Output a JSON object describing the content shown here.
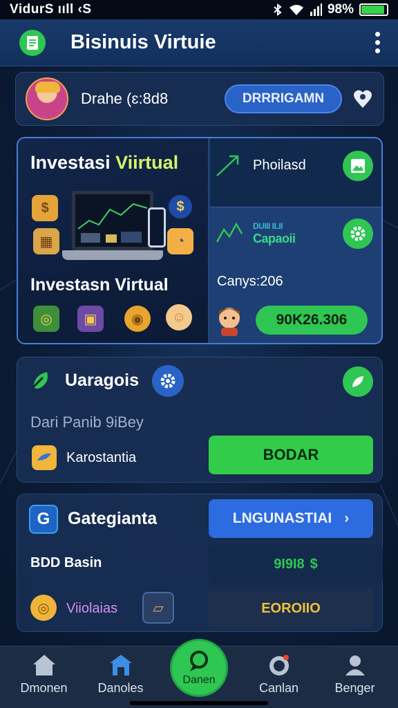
{
  "status_bar": {
    "left": "VidurS ııll  ‹S",
    "battery": "98%"
  },
  "app_bar": {
    "title": "Bisinuis Virtuie"
  },
  "profile": {
    "name": "Drahe (ɛ:8d8",
    "button": "DRRRIGAMN"
  },
  "invest_card": {
    "title_1_a": "Investasi ",
    "title_1_b": "Viirtual",
    "title_2": "Investasn Virtual",
    "portfolio_label": "Phoilasd",
    "data_label_1": "DUIII ILII",
    "data_label_2": "Capaoii",
    "change_label": "Canys:206",
    "balance_button": "90K26.306"
  },
  "section_2": {
    "title": "Uaragois",
    "subtitle": "Dari  Panib 9iBey",
    "row_label": "Karostantia",
    "button": "BODAR"
  },
  "section_3": {
    "title": "Gategianta",
    "button": "LNGUNASTIAI",
    "label_1": "BDD  Basin",
    "value_1": "9I9I8",
    "value_1_symbol": "$",
    "label_2": "Viiolaias",
    "value_2": "EOROIIO"
  },
  "bottom_nav": {
    "items": [
      {
        "label": "Dmonen",
        "icon": "home-icon"
      },
      {
        "label": "Danoles",
        "icon": "store-icon"
      },
      {
        "label": "Danen",
        "icon": "chat-icon"
      },
      {
        "label": "Canlan",
        "icon": "record-icon"
      },
      {
        "label": "Benger",
        "icon": "person-icon"
      }
    ]
  },
  "colors": {
    "accent_green": "#2fc653",
    "accent_blue": "#2c6be0",
    "background": "#0d1f3c"
  }
}
